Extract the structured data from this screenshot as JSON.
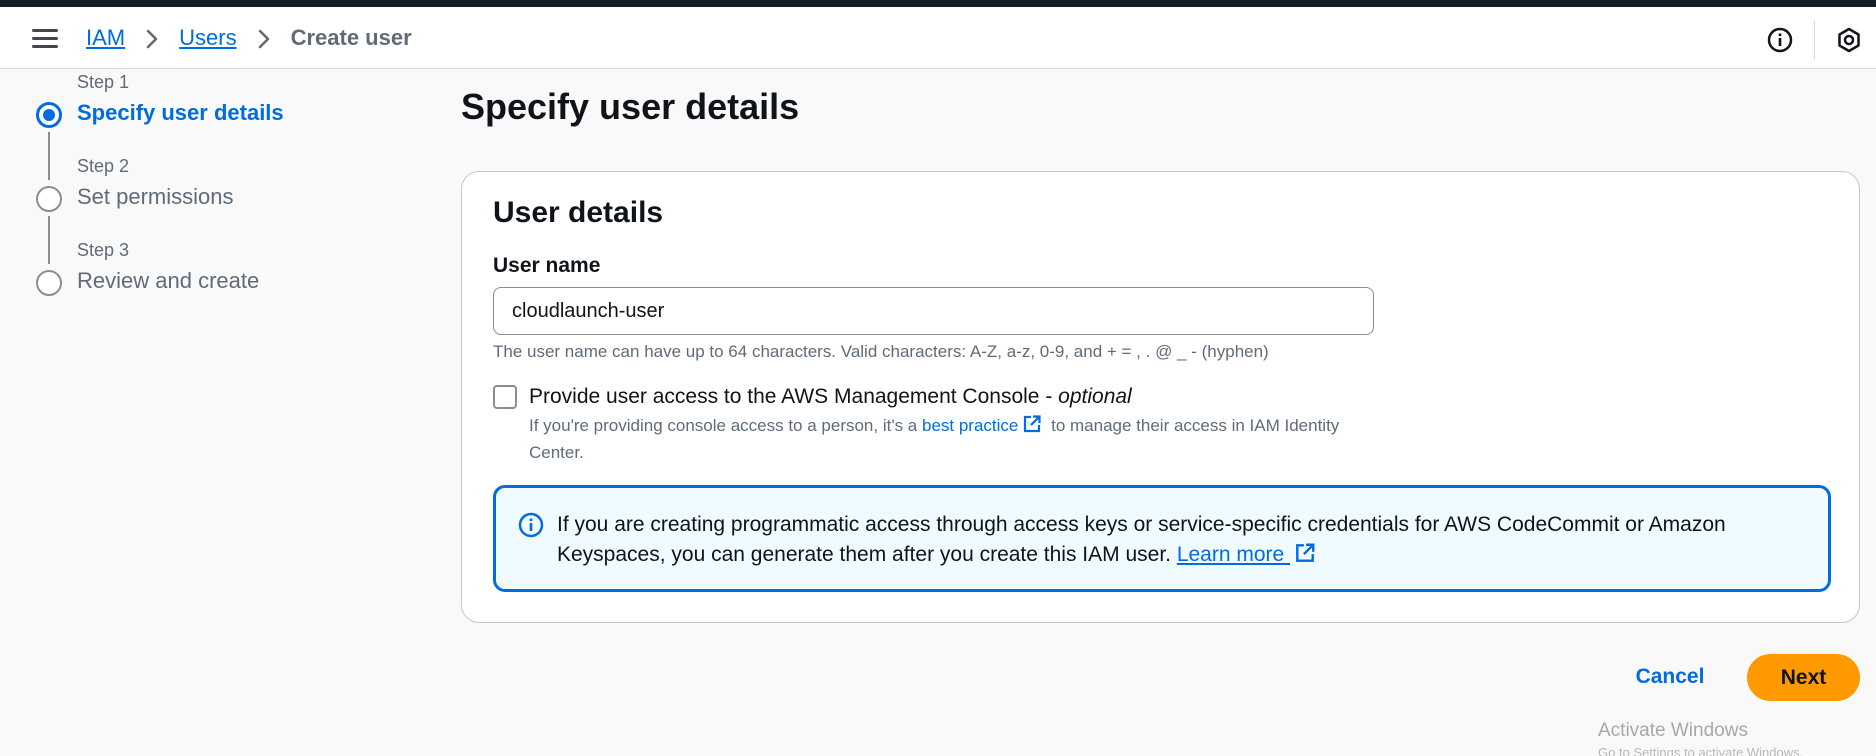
{
  "breadcrumb": {
    "items": [
      {
        "label": "IAM"
      },
      {
        "label": "Users"
      }
    ],
    "current": "Create user"
  },
  "steps": [
    {
      "number": "Step 1",
      "title": "Specify user details",
      "state": "active"
    },
    {
      "number": "Step 2",
      "title": "Set permissions",
      "state": "inactive"
    },
    {
      "number": "Step 3",
      "title": "Review and create",
      "state": "inactive"
    }
  ],
  "page": {
    "title": "Specify user details"
  },
  "panel": {
    "title": "User details",
    "user_name_label": "User name",
    "user_name_value": "cloudlaunch-user",
    "user_name_hint": "The user name can have up to 64 characters. Valid characters: A-Z, a-z, 0-9, and + = , . @ _ - (hyphen)",
    "console_access": {
      "checked": false,
      "label": "Provide user access to the AWS Management Console - ",
      "label_suffix": "optional",
      "desc_prefix": "If you're providing console access to a person, it's a ",
      "desc_link": "best practice",
      "desc_suffix": " to manage their access in IAM Identity Center."
    }
  },
  "alert": {
    "text": "If you are creating programmatic access through access keys or service-specific credentials for AWS CodeCommit or Amazon Keyspaces, you can generate them after you create this IAM user. ",
    "link": "Learn more "
  },
  "actions": {
    "cancel": "Cancel",
    "next": "Next"
  },
  "watermark": {
    "line1": "Activate Windows",
    "line2": "Go to Settings to activate Windows."
  },
  "colors": {
    "accent": "#006ce0",
    "primary_button": "#ff9900",
    "alert_background": "#f0fbff"
  }
}
